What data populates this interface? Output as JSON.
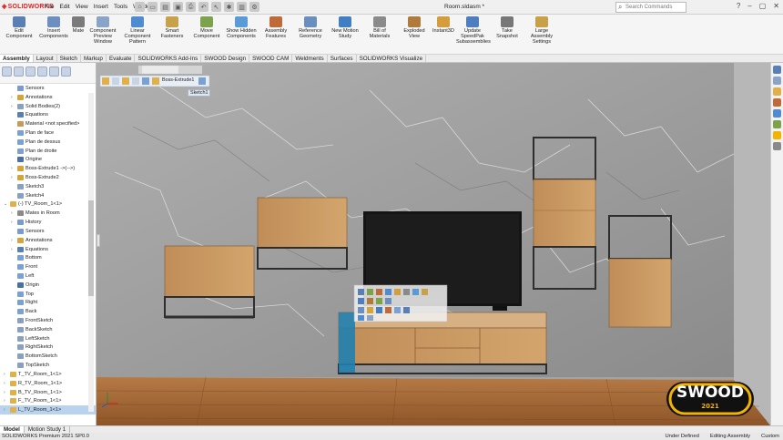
{
  "window": {
    "brand": "SOLIDWORKS",
    "menus": [
      "File",
      "Edit",
      "View",
      "Insert",
      "Tools",
      "Window"
    ],
    "doc_title": "Room.sldasm *",
    "search_placeholder": "Search Commands",
    "controls": [
      "?",
      "–",
      "▢",
      "✕"
    ]
  },
  "ribbon": [
    {
      "label": "Edit Component",
      "color": "#5a7fb5"
    },
    {
      "label": "Insert Components",
      "color": "#6c8fbf"
    },
    {
      "label": "Mate",
      "color": "#7a7a7a"
    },
    {
      "label": "Component Preview Window",
      "color": "#8aa4c8"
    },
    {
      "label": "Linear Component Pattern",
      "color": "#4f8bd0"
    },
    {
      "label": "Smart Fasteners",
      "color": "#c8a24a"
    },
    {
      "label": "Move Component",
      "color": "#7ca34c"
    },
    {
      "label": "Show Hidden Components",
      "color": "#5a9ad6"
    },
    {
      "label": "Assembly Features",
      "color": "#c06a3a"
    },
    {
      "label": "Reference Geometry",
      "color": "#6a8fbf"
    },
    {
      "label": "New Motion Study",
      "color": "#3f7fc2"
    },
    {
      "label": "Bill of Materials",
      "color": "#8a8a8a"
    },
    {
      "label": "Exploded View",
      "color": "#b07a3c"
    },
    {
      "label": "Instant3D",
      "color": "#d49c3a"
    },
    {
      "label": "Update SpeedPak Subassemblies",
      "color": "#4f7ec0"
    },
    {
      "label": "Take Snapshot",
      "color": "#777777"
    },
    {
      "label": "Large Assembly Settings",
      "color": "#c8a04a"
    }
  ],
  "tabs": [
    {
      "label": "Assembly",
      "active": true
    },
    {
      "label": "Layout",
      "active": false
    },
    {
      "label": "Sketch",
      "active": false
    },
    {
      "label": "Markup",
      "active": false
    },
    {
      "label": "Evaluate",
      "active": false
    },
    {
      "label": "SOLIDWORKS Add-Ins",
      "active": false
    },
    {
      "label": "SWOOD Design",
      "active": false
    },
    {
      "label": "SWOOD CAM",
      "active": false
    },
    {
      "label": "Weldments",
      "active": false
    },
    {
      "label": "Surfaces",
      "active": false
    },
    {
      "label": "SOLIDWORKS Visualize",
      "active": false
    }
  ],
  "tree": [
    {
      "label": "Sensors",
      "indent": 1,
      "arrow": "",
      "color": "#7a9bd0",
      "selected": false
    },
    {
      "label": "Annotations",
      "indent": 1,
      "arrow": "›",
      "color": "#d4a53a",
      "selected": false
    },
    {
      "label": "Solid Bodies(2)",
      "indent": 1,
      "arrow": "›",
      "color": "#8aa0c0",
      "selected": false
    },
    {
      "label": "Equations",
      "indent": 1,
      "arrow": "",
      "color": "#5a7fb5",
      "selected": false
    },
    {
      "label": "Material <not specified>",
      "indent": 1,
      "arrow": "",
      "color": "#c99a5a",
      "selected": false
    },
    {
      "label": "Plan de face",
      "indent": 1,
      "arrow": "",
      "color": "#7aa0d4",
      "selected": false
    },
    {
      "label": "Plan de dessus",
      "indent": 1,
      "arrow": "",
      "color": "#7aa0d4",
      "selected": false
    },
    {
      "label": "Plan de droite",
      "indent": 1,
      "arrow": "",
      "color": "#7aa0d4",
      "selected": false
    },
    {
      "label": "Origine",
      "indent": 1,
      "arrow": "",
      "color": "#4a6fa0",
      "selected": false
    },
    {
      "label": "Boss-Extrude1 ->(-->)",
      "indent": 1,
      "arrow": "›",
      "color": "#d4a53a",
      "selected": false
    },
    {
      "label": "Boss-Extrude2",
      "indent": 1,
      "arrow": "›",
      "color": "#d4a53a",
      "selected": false
    },
    {
      "label": "Sketch3",
      "indent": 1,
      "arrow": "",
      "color": "#8aa0c0",
      "selected": false
    },
    {
      "label": "Sketch4",
      "indent": 1,
      "arrow": "",
      "color": "#8aa0c0",
      "selected": false
    },
    {
      "label": "(-) TV_Room_1<1>",
      "indent": 0,
      "arrow": "⌄",
      "color": "#e0b04a",
      "selected": false
    },
    {
      "label": "Mates in Room",
      "indent": 1,
      "arrow": "›",
      "color": "#8a8a8a",
      "selected": false
    },
    {
      "label": "History",
      "indent": 1,
      "arrow": "›",
      "color": "#7a9bd0",
      "selected": false
    },
    {
      "label": "Sensors",
      "indent": 1,
      "arrow": "",
      "color": "#7a9bd0",
      "selected": false
    },
    {
      "label": "Annotations",
      "indent": 1,
      "arrow": "›",
      "color": "#d4a53a",
      "selected": false
    },
    {
      "label": "Equations",
      "indent": 1,
      "arrow": "›",
      "color": "#5a7fb5",
      "selected": false
    },
    {
      "label": "Bottom",
      "indent": 1,
      "arrow": "",
      "color": "#7aa0d4",
      "selected": false
    },
    {
      "label": "Front",
      "indent": 1,
      "arrow": "",
      "color": "#7aa0d4",
      "selected": false
    },
    {
      "label": "Left",
      "indent": 1,
      "arrow": "",
      "color": "#7aa0d4",
      "selected": false
    },
    {
      "label": "Origin",
      "indent": 1,
      "arrow": "",
      "color": "#4a6fa0",
      "selected": false
    },
    {
      "label": "Top",
      "indent": 1,
      "arrow": "",
      "color": "#7aa0d4",
      "selected": false
    },
    {
      "label": "Right",
      "indent": 1,
      "arrow": "",
      "color": "#7aa0d4",
      "selected": false
    },
    {
      "label": "Back",
      "indent": 1,
      "arrow": "",
      "color": "#7aa0d4",
      "selected": false
    },
    {
      "label": "FrontSketch",
      "indent": 1,
      "arrow": "",
      "color": "#8aa0c0",
      "selected": false
    },
    {
      "label": "BackSketch",
      "indent": 1,
      "arrow": "",
      "color": "#8aa0c0",
      "selected": false
    },
    {
      "label": "LeftSketch",
      "indent": 1,
      "arrow": "",
      "color": "#8aa0c0",
      "selected": false
    },
    {
      "label": "RightSketch",
      "indent": 1,
      "arrow": "",
      "color": "#8aa0c0",
      "selected": false
    },
    {
      "label": "BottomSketch",
      "indent": 1,
      "arrow": "",
      "color": "#8aa0c0",
      "selected": false
    },
    {
      "label": "TopSketch",
      "indent": 1,
      "arrow": "",
      "color": "#8aa0c0",
      "selected": false
    },
    {
      "label": "T_TV_Room_1<1>",
      "indent": 0,
      "arrow": "›",
      "color": "#e0b04a",
      "selected": false
    },
    {
      "label": "R_TV_Room_1<1>",
      "indent": 0,
      "arrow": "›",
      "color": "#e0b04a",
      "selected": false
    },
    {
      "label": "B_TV_Room_1<1>",
      "indent": 0,
      "arrow": "›",
      "color": "#e0b04a",
      "selected": false
    },
    {
      "label": "F_TV_Room_1<1>",
      "indent": 0,
      "arrow": "›",
      "color": "#e0b04a",
      "selected": false
    },
    {
      "label": "L_TV_Room_1<1>",
      "indent": 0,
      "arrow": "›",
      "color": "#e0b04a",
      "selected": true
    }
  ],
  "breadcrumb": {
    "item1": "Boss-Extrude1",
    "item2": "Sketch1"
  },
  "swood": {
    "name": "SWOOD",
    "year": "2021"
  },
  "model_tabs": [
    {
      "label": "Model",
      "active": true
    },
    {
      "label": "Motion Study 1",
      "active": false
    }
  ],
  "status": {
    "left": "SOLIDWORKS Premium 2021 SP0.0",
    "right1": "Under Defined",
    "right2": "Editing Assembly",
    "right3": "Custom"
  },
  "colors": {
    "wood": "#c99862",
    "wood_dark": "#a9773f",
    "metal": "#2e2e2e",
    "tv": "#141414",
    "floor": "#a66a3a",
    "accent_blue": "#1f7fb0",
    "swood_yellow": "#f2b400"
  }
}
